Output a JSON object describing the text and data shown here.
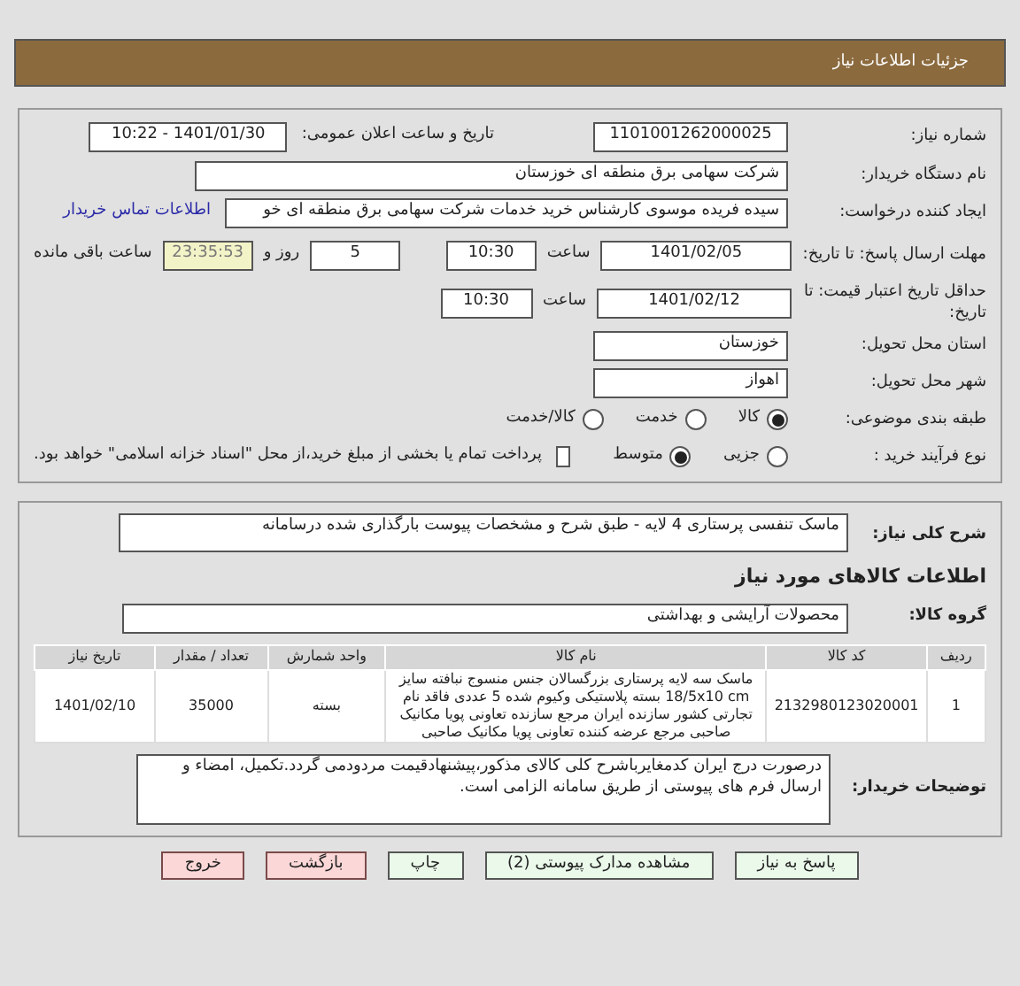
{
  "header": {
    "title": "جزئیات اطلاعات نیاز"
  },
  "need_number": {
    "label": "شماره نیاز:",
    "value": "1101001262000025"
  },
  "announce": {
    "label": "تاریخ و ساعت اعلان عمومی:",
    "value": "1401/01/30 - 10:22"
  },
  "buyer": {
    "label": "نام دستگاه خریدار:",
    "value": "شرکت سهامی برق منطقه ای خوزستان"
  },
  "creator": {
    "label": "ایجاد کننده درخواست:",
    "value": "سیده فریده موسوی کارشناس خرید خدمات شرکت سهامی برق منطقه ای خو",
    "link": "اطلاعات تماس خریدار"
  },
  "deadline": {
    "label": "مهلت ارسال پاسخ: تا تاریخ:",
    "date": "1401/02/05",
    "time_label": "ساعت",
    "time": "10:30",
    "days": "5",
    "days_label": "روز و",
    "remaining": "23:35:53",
    "remaining_label": "ساعت باقی مانده"
  },
  "validity": {
    "label": "حداقل تاریخ اعتبار قیمت: تا تاریخ:",
    "date": "1401/02/12",
    "time_label": "ساعت",
    "time": "10:30"
  },
  "province": {
    "label": "استان محل تحویل:",
    "value": "خوزستان"
  },
  "city": {
    "label": "شهر محل تحویل:",
    "value": "اهواز"
  },
  "category": {
    "label": "طبقه بندی موضوعی:",
    "options": [
      {
        "label": "کالا",
        "selected": true
      },
      {
        "label": "خدمت",
        "selected": false
      },
      {
        "label": "کالا/خدمت",
        "selected": false
      }
    ]
  },
  "process": {
    "label": "نوع فرآیند خرید :",
    "options": [
      {
        "label": "جزیی",
        "selected": false
      },
      {
        "label": "متوسط",
        "selected": true
      }
    ],
    "payment": {
      "checked": false,
      "label": "پرداخت تمام یا بخشی از مبلغ خرید،از محل \"اسناد خزانه اسلامی\" خواهد بود."
    }
  },
  "summary": {
    "label": "شرح کلی نیاز:",
    "value": "ماسک تنفسی پرستاری 4 لایه - طبق شرح و مشخصات پیوست بارگذاری شده درسامانه"
  },
  "goods_heading": "اطلاعات کالاهای مورد نیاز",
  "goods_group": {
    "label": "گروه کالا:",
    "value": "محصولات آرایشی و بهداشتی"
  },
  "table": {
    "columns": [
      "ردیف",
      "کد کالا",
      "نام کالا",
      "واحد شمارش",
      "تعداد / مقدار",
      "تاریخ نیاز"
    ],
    "rows": [
      [
        "1",
        "2132980123020001",
        "ماسک سه لایه پرستاری بزرگسالان جنس منسوج نبافته سایز 18/5x10 cm بسته پلاستیکی وکیوم شده 5 عددی فاقد نام تجارتی کشور سازنده ایران مرجع سازنده تعاونی پویا مکانیک صاحبی مرجع عرضه کننده تعاونی پویا مکانیک صاحبی",
        "بسته",
        "35000",
        "1401/02/10"
      ]
    ]
  },
  "notes": {
    "label": "توضیحات خریدار:",
    "value": "درصورت درج ایران کدمغایرباشرح کلی کالای مذکور،پیشنهادقیمت مردودمی گردد.تکمیل، امضاء و ارسال فرم های پیوستی از طریق سامانه الزامی است."
  },
  "buttons": [
    {
      "label": "پاسخ به نیاز",
      "kind": "action"
    },
    {
      "label": "مشاهده مدارک پیوستی (2)",
      "kind": "action"
    },
    {
      "label": "چاپ",
      "kind": "action"
    },
    {
      "label": "بازگشت",
      "kind": "exit"
    },
    {
      "label": "خروج",
      "kind": "exit"
    }
  ]
}
